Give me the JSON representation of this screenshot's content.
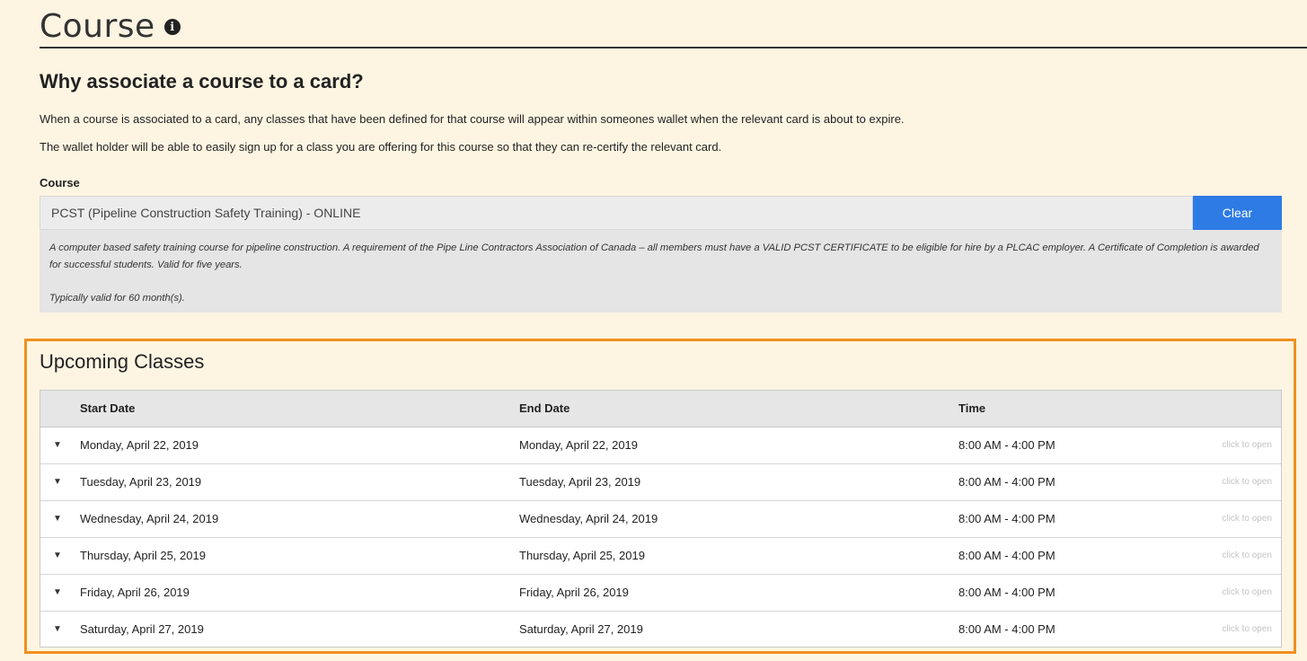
{
  "header": {
    "title": "Course"
  },
  "why": {
    "heading": "Why associate a course to a card?",
    "paragraph1": "When a course is associated to a card, any classes that have been defined for that course will appear within someones wallet when the relevant card is about to expire.",
    "paragraph2": "The wallet holder will be able to easily sign up for a class you are offering for this course so that they can re-certify the relevant card."
  },
  "course": {
    "label": "Course",
    "value": "PCST (Pipeline Construction Safety Training) - ONLINE",
    "clear_label": "Clear",
    "description": "A computer based safety training course for pipeline construction. A requirement of the Pipe Line Contractors Association of Canada – all members must have a VALID PCST CERTIFICATE to be eligible for hire by a PLCAC employer. A Certificate of Completion is awarded for successful students. Valid for five years.",
    "validity": "Typically valid for 60 month(s)."
  },
  "upcoming": {
    "title": "Upcoming Classes",
    "columns": [
      "Start Date",
      "End Date",
      "Time"
    ],
    "open_hint": "click to open",
    "rows": [
      {
        "start": "Monday, April 22, 2019",
        "end": "Monday, April 22, 2019",
        "time": "8:00 AM - 4:00 PM"
      },
      {
        "start": "Tuesday, April 23, 2019",
        "end": "Tuesday, April 23, 2019",
        "time": "8:00 AM - 4:00 PM"
      },
      {
        "start": "Wednesday, April 24, 2019",
        "end": "Wednesday, April 24, 2019",
        "time": "8:00 AM - 4:00 PM"
      },
      {
        "start": "Thursday, April 25, 2019",
        "end": "Thursday, April 25, 2019",
        "time": "8:00 AM - 4:00 PM"
      },
      {
        "start": "Friday, April 26, 2019",
        "end": "Friday, April 26, 2019",
        "time": "8:00 AM - 4:00 PM"
      },
      {
        "start": "Saturday, April 27, 2019",
        "end": "Saturday, April 27, 2019",
        "time": "8:00 AM - 4:00 PM"
      }
    ]
  },
  "icons": {
    "info": "info-icon",
    "row_toggle": "caret-down-icon"
  },
  "colors": {
    "page_background": "#fdf5e2",
    "clear_button": "#2e7be6",
    "highlight_border": "#f0901c"
  }
}
